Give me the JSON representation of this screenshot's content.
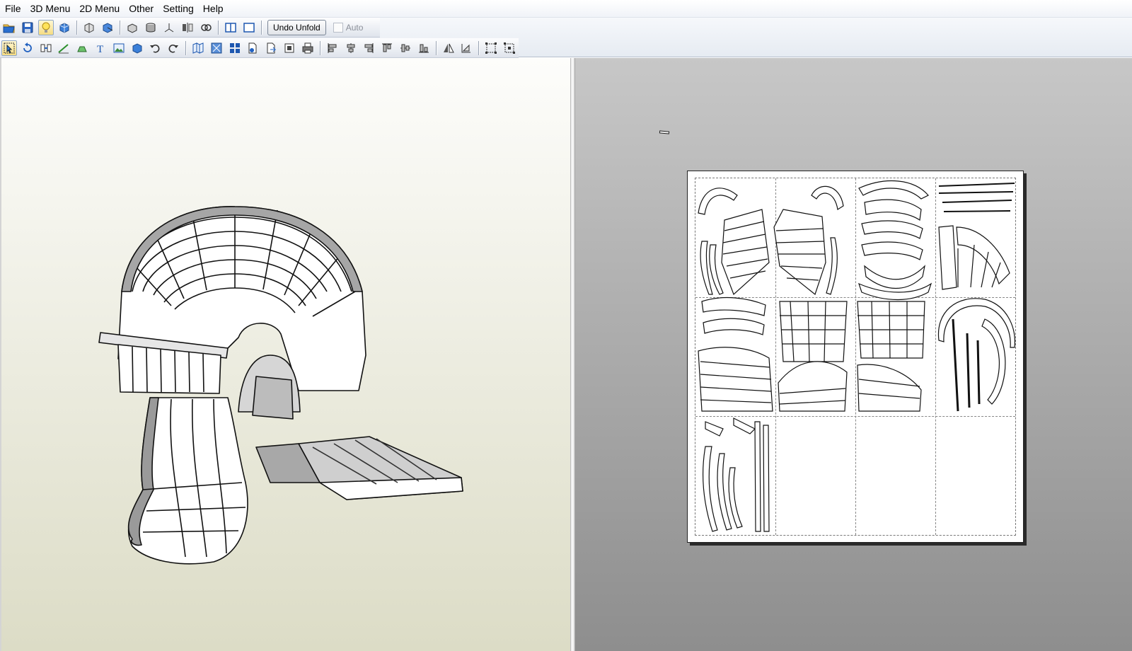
{
  "menu": {
    "items": [
      "File",
      "3D Menu",
      "2D Menu",
      "Other",
      "Setting",
      "Help"
    ]
  },
  "toolbar": {
    "undo_unfold_label": "Undo Unfold",
    "auto_label": "Auto",
    "auto_checked": false,
    "top_icons": [
      "open-icon",
      "save-icon",
      "light-bulb-icon",
      "texture-icon",
      "rotate-model-icon",
      "unfold-icon",
      "box-icon",
      "cylinder-icon",
      "axis-icon",
      "mirror-icon",
      "link-icon",
      "split-view-icon",
      "single-view-icon"
    ],
    "bottom_icons": [
      "select-icon",
      "rotate-part-icon",
      "join-icon",
      "line-icon",
      "flap-icon",
      "text-icon",
      "image-icon",
      "cube-icon",
      "undo-icon",
      "redo-icon",
      "page-layout-icon",
      "fit-icon",
      "arrange-icon",
      "page-add-icon",
      "page-export-icon",
      "print-setup-icon",
      "print-icon",
      "align-left-icon",
      "align-center-icon",
      "align-right-icon",
      "align-top-icon",
      "align-middle-icon",
      "align-bottom-icon",
      "flip-h-icon",
      "flip-v-icon",
      "group-icon",
      "ungroup-icon"
    ]
  },
  "colors": {
    "menubar": "#f0f3f8",
    "viewport3d_top": "#fdfdfb",
    "viewport3d_bottom": "#dcdcc6",
    "viewport2d_top": "#c7c7c7",
    "viewport2d_bottom": "#8e8e8e"
  }
}
